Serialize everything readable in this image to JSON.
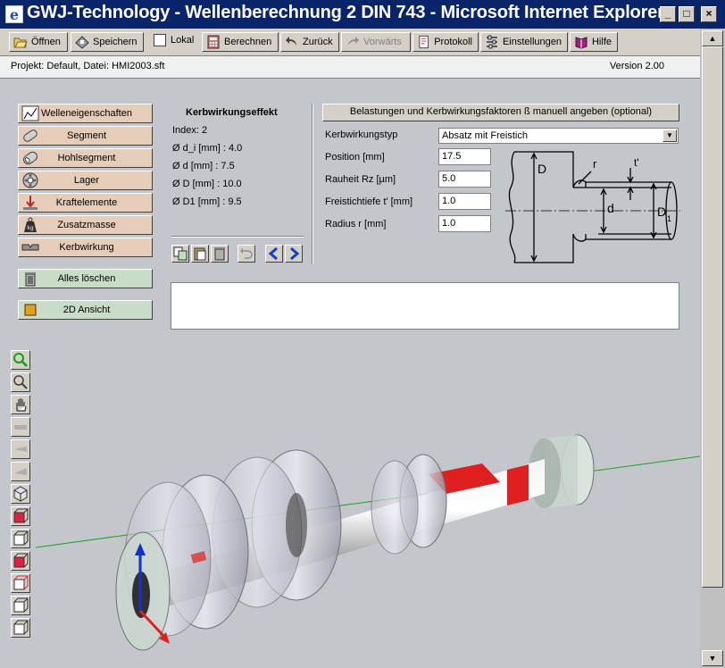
{
  "window": {
    "title": "GWJ-Technology - Wellenberechnung 2 DIN 743 - Microsoft Internet Explorer",
    "minimize": "_",
    "maximize": "□",
    "close": "×"
  },
  "toolbar": {
    "open": "Öffnen",
    "save": "Speichern",
    "local": "Lokal",
    "calculate": "Berechnen",
    "back": "Zurück",
    "forward": "Vorwärts",
    "protocol": "Protokoll",
    "settings": "Einstellungen",
    "help": "Hilfe"
  },
  "info": {
    "project": "Projekt: Default,  Datei: HMI2003.sft",
    "version": "Version 2.00"
  },
  "sidebar": {
    "items": [
      {
        "label": "Welleneigenschaften",
        "icon": "chart-icon"
      },
      {
        "label": "Segment",
        "icon": "segment-icon"
      },
      {
        "label": "Hohlsegment",
        "icon": "hollow-segment-icon"
      },
      {
        "label": "Lager",
        "icon": "bearing-icon"
      },
      {
        "label": "Kraftelemente",
        "icon": "force-icon"
      },
      {
        "label": "Zusatzmasse",
        "icon": "weight-icon"
      },
      {
        "label": "Kerbwirkung",
        "icon": "notch-icon"
      }
    ],
    "clear_all": "Alles löschen",
    "view_2d": "2D Ansicht"
  },
  "notch": {
    "title": "Kerbwirkungseffekt",
    "index": "Index: 2",
    "d_i": "Ø d_i [mm] : 4.0",
    "d": "Ø d [mm] : 7.5",
    "D": "Ø D [mm] : 10.0",
    "D1": "Ø D1 [mm] : 9.5"
  },
  "form": {
    "manual_button": "Belastungen und Kerbwirkungsfaktoren ß manuell angeben (optional)",
    "type_label": "Kerbwirkungstyp",
    "type_value": "Absatz mit Freistich",
    "position_label": "Position [mm]",
    "position_value": "17.5",
    "roughness_label": "Rauheit Rz [µm]",
    "roughness_value": "5.0",
    "depth_label": "Freistichtiefe t' [mm]",
    "depth_value": "1.0",
    "radius_label": "Radius r [mm]",
    "radius_value": "1.0"
  },
  "diagram": {
    "D": "D",
    "d": "d",
    "D1": "D",
    "D1_sub": "1",
    "r": "r",
    "t": "t'"
  },
  "colors": {
    "titlebar": "#0a246a",
    "button_fill": "#e5cdb9",
    "highlight_red": "#e02020",
    "axis_green": "#20a020",
    "axis_blue": "#1030d0"
  }
}
